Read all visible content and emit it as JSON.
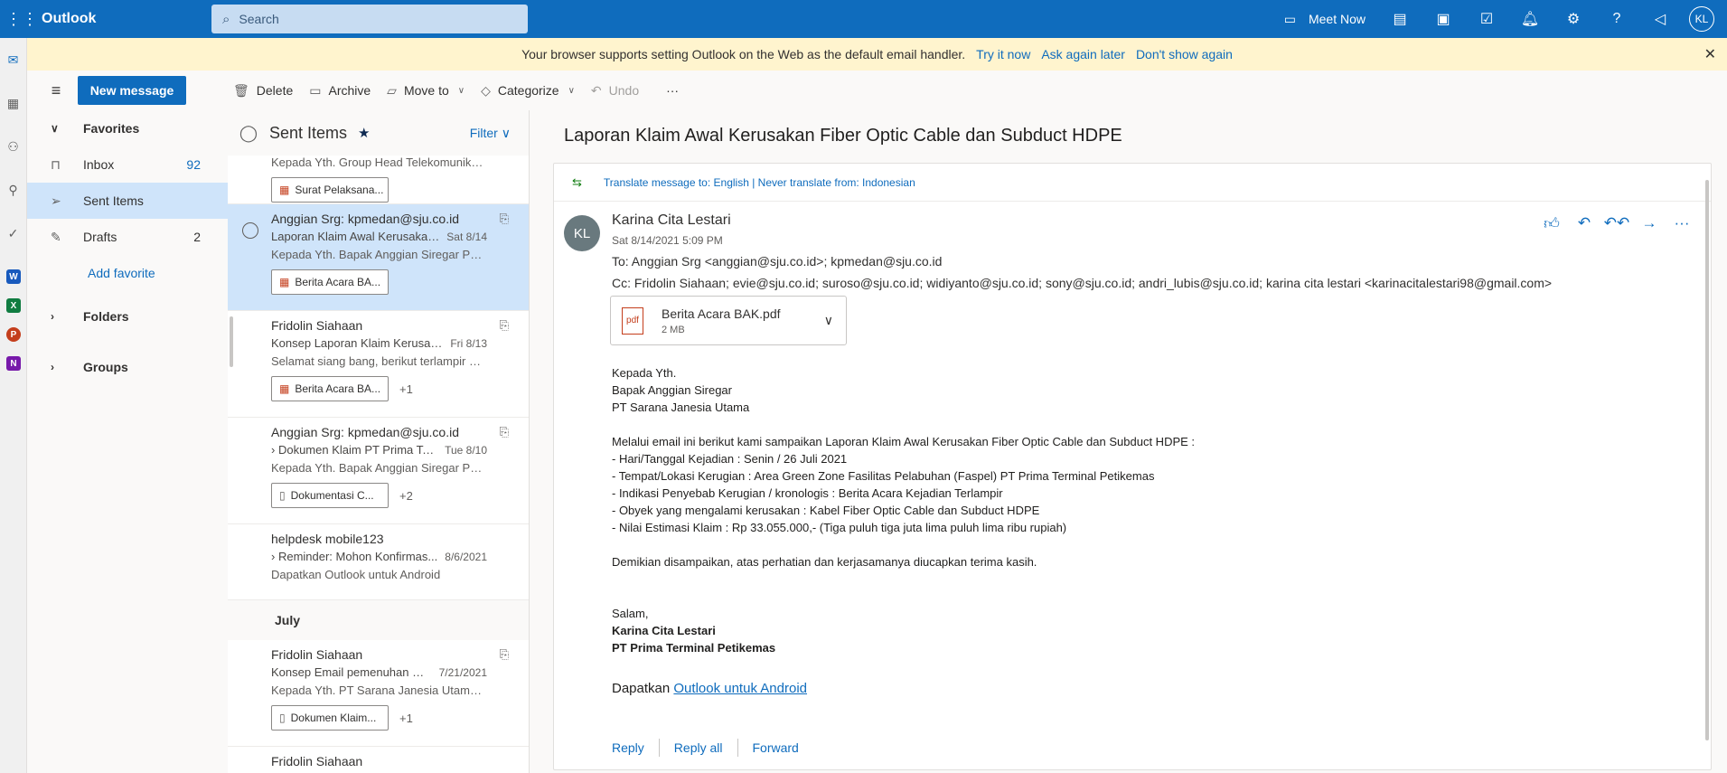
{
  "app": {
    "title": "Outlook"
  },
  "search": {
    "placeholder": "Search"
  },
  "topbar": {
    "meet_now": "Meet Now",
    "avatar_initials": "KL"
  },
  "banner": {
    "text": "Your browser supports setting Outlook on the Web as the default email handler.",
    "try": "Try it now",
    "later": "Ask again later",
    "never": "Don't show again"
  },
  "toolbar": {
    "new_message": "New message",
    "delete": "Delete",
    "archive": "Archive",
    "move_to": "Move to",
    "categorize": "Categorize",
    "undo": "Undo"
  },
  "folders": {
    "favorites": "Favorites",
    "inbox": "Inbox",
    "inbox_count": "92",
    "sent": "Sent Items",
    "drafts": "Drafts",
    "drafts_count": "2",
    "add_favorite": "Add favorite",
    "folders": "Folders",
    "groups": "Groups"
  },
  "list": {
    "title": "Sent Items",
    "filter": "Filter",
    "messages": [
      {
        "from": "",
        "subject": "",
        "date": "",
        "preview": "Kepada Yth. Group Head Telekomunikasi ...",
        "attachment": "Surat Pelaksana...",
        "more": ""
      },
      {
        "from": "Anggian Srg: kpmedan@sju.co.id",
        "subject": "Laporan Klaim Awal Kerusakan ...",
        "date": "Sat 8/14",
        "preview": "Kepada Yth. Bapak Anggian Siregar PT Sa...",
        "attachment": "Berita Acara BA...",
        "more": ""
      },
      {
        "from": "Fridolin Siahaan",
        "subject": "Konsep Laporan Klaim Kerusaka...",
        "date": "Fri 8/13",
        "preview": "Selamat siang bang, berikut terlampir dis...",
        "attachment": "Berita Acara BA...",
        "more": "+1"
      },
      {
        "from": "Anggian Srg: kpmedan@sju.co.id",
        "subject": "Dokumen Klaim PT Prima Ter...",
        "date": "Tue 8/10",
        "preview": "Kepada Yth. Bapak Anggian Siregar PT Sa...",
        "attachment": "Dokumentasi C...",
        "more": "+2"
      },
      {
        "from": "helpdesk mobile123",
        "subject": "Reminder: Mohon Konfirmas...",
        "date": "8/6/2021",
        "preview": "Dapatkan Outlook untuk Android",
        "attachment": "",
        "more": ""
      },
      {
        "from": "Fridolin Siahaan",
        "subject": "Konsep Email pemenuhan Do...",
        "date": "7/21/2021",
        "preview": "Kepada Yth. PT Sarana Janesia Utama di T...",
        "attachment": "Dokumen Klaim...",
        "more": "+1"
      },
      {
        "from": "Fridolin Siahaan",
        "subject": "",
        "date": "",
        "preview": "",
        "attachment": "",
        "more": ""
      }
    ],
    "group_july": "July"
  },
  "reading": {
    "subject": "Laporan Klaim Awal Kerusakan Fiber Optic Cable dan Subduct HDPE",
    "translate": "Translate message to: English | Never translate from: Indonesian",
    "sender_initials": "KL",
    "sender": "Karina Cita Lestari",
    "date": "Sat 8/14/2021 5:09 PM",
    "to": "To:  Anggian Srg <anggian@sju.co.id>; kpmedan@sju.co.id",
    "cc": "Cc:  Fridolin Siahaan; evie@sju.co.id; suroso@sju.co.id; widiyanto@sju.co.id; sony@sju.co.id; andri_lubis@sju.co.id; karina cita lestari <karinacitalestari98@gmail.com>",
    "attachment": {
      "name": "Berita Acara BAK.pdf",
      "size": "2 MB"
    },
    "body": {
      "l1": "Kepada Yth.",
      "l2": "Bapak Anggian Siregar",
      "l3": "PT Sarana Janesia Utama",
      "l4": "Melalui email ini berikut kami sampaikan Laporan Klaim Awal Kerusakan Fiber Optic Cable dan Subduct HDPE :",
      "l5": "- Hari/Tanggal Kejadian : Senin / 26 Juli 2021",
      "l6": "- Tempat/Lokasi Kerugian : Area Green Zone Fasilitas Pelabuhan (Faspel) PT Prima Terminal Petikemas",
      "l7": "- Indikasi Penyebab Kerugian / kronologis : Berita Acara Kejadian Terlampir",
      "l8": "- Obyek yang mengalami kerusakan :  Kabel Fiber Optic Cable dan Subduct HDPE",
      "l9": "- Nilai Estimasi Klaim : Rp 33.055.000,- (Tiga puluh tiga juta lima puluh lima ribu rupiah)",
      "l10": "Demikian disampaikan, atas perhatian dan kerjasamanya diucapkan terima kasih.",
      "l11": "Salam,",
      "l12": "Karina Cita Lestari",
      "l13": "PT Prima Terminal Petikemas",
      "android_prefix": "Dapatkan",
      "android_link": "Outlook untuk Android"
    },
    "reply": "Reply",
    "reply_all": "Reply all",
    "forward": "Forward"
  }
}
